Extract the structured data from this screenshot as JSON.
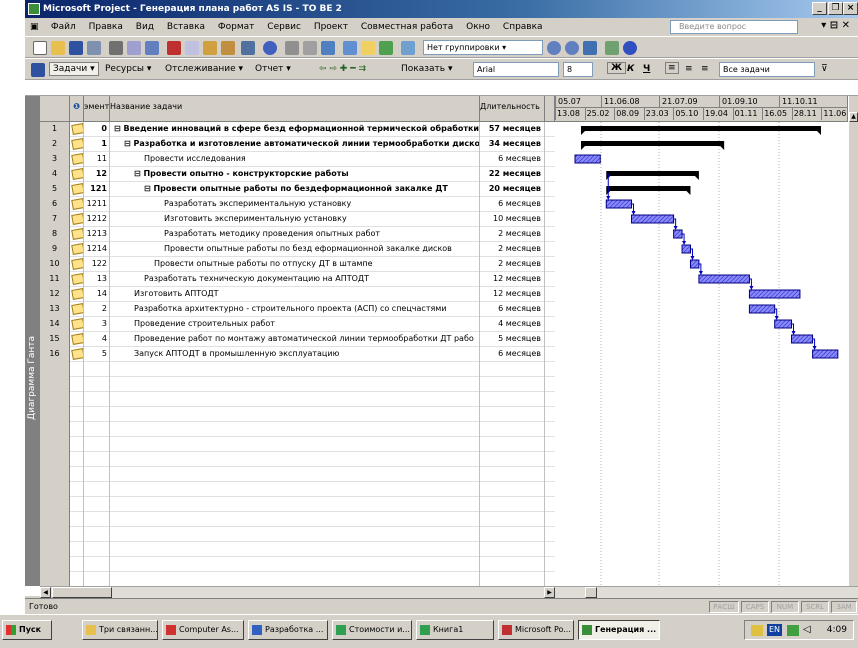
{
  "window": {
    "title": "Microsoft Project - Генерация плана работ AS IS - TO BE 2",
    "ask_placeholder": "Введите вопрос"
  },
  "menu": [
    "Файл",
    "Правка",
    "Вид",
    "Вставка",
    "Формат",
    "Сервис",
    "Проект",
    "Совместная работа",
    "Окно",
    "Справка"
  ],
  "toolbar1": {
    "grouping_label": "Нет группировки"
  },
  "toolbar2": {
    "tasks_label": "Задачи",
    "resources_label": "Ресурсы",
    "tracking_label": "Отслеживание",
    "report_label": "Отчет",
    "show_label": "Показать",
    "font_name": "Arial",
    "font_size": "8",
    "bold_label": "Ж",
    "italic_label": "К",
    "underline_label": "Ч",
    "filter_value": "Все задачи"
  },
  "view_tab": "Диаграмма Ганта",
  "columns": {
    "wbs": "эмент",
    "name": "Название задачи",
    "duration": "Длительность"
  },
  "timescale": {
    "top": [
      "05.07",
      "11.06.08",
      "21.07.09",
      "01.09.10",
      "11.10.11"
    ],
    "bottom": [
      "13.08",
      "25.02",
      "08.09",
      "23.03",
      "05.10",
      "19.04",
      "01.11",
      "16.05",
      "28.11",
      "11.06"
    ]
  },
  "tasks": [
    {
      "id": "1",
      "wbs": "0",
      "name": "⊟ Введение инноваций  в сфере безд еформационной термической обработки д",
      "duration": "57 месяцев",
      "bold": true,
      "indent": 0
    },
    {
      "id": "2",
      "wbs": "1",
      "name": "⊟ Разработка и изготовление автоматической линии термообработки дисков",
      "duration": "34 месяцев",
      "bold": true,
      "indent": 1
    },
    {
      "id": "3",
      "wbs": "11",
      "name": "Провести  исследования",
      "duration": "6 месяцев",
      "bold": false,
      "indent": 3
    },
    {
      "id": "4",
      "wbs": "12",
      "name": "⊟ Провести опытно - конструкторские работы",
      "duration": "22 месяцев",
      "bold": true,
      "indent": 2
    },
    {
      "id": "5",
      "wbs": "121",
      "name": "⊟ Провести опытные работы по  бездеформационной закалке ДТ",
      "duration": "20 месяцев",
      "bold": true,
      "indent": 3
    },
    {
      "id": "6",
      "wbs": "1211",
      "name": "Разработать экспериментальную  установку",
      "duration": "6 месяцев",
      "bold": false,
      "indent": 5
    },
    {
      "id": "7",
      "wbs": "1212",
      "name": "Изготовить  экспериментальную  установку",
      "duration": "10 месяцев",
      "bold": false,
      "indent": 5
    },
    {
      "id": "8",
      "wbs": "1213",
      "name": "Разработать  методику  проведения  опытных работ",
      "duration": "2 месяцев",
      "bold": false,
      "indent": 5
    },
    {
      "id": "9",
      "wbs": "1214",
      "name": "Провести  опытные  работы по безд еформационной закалке дисков",
      "duration": "2 месяцев",
      "bold": false,
      "indent": 5
    },
    {
      "id": "10",
      "wbs": "122",
      "name": "Провести опытные работы по отпуску ДТ в штампе",
      "duration": "2 месяцев",
      "bold": false,
      "indent": 4
    },
    {
      "id": "11",
      "wbs": "13",
      "name": "Разработать техническую документацию на АПТОДТ",
      "duration": "12 месяцев",
      "bold": false,
      "indent": 3
    },
    {
      "id": "12",
      "wbs": "14",
      "name": "Изготовить АПТОДТ",
      "duration": "12 месяцев",
      "bold": false,
      "indent": 2
    },
    {
      "id": "13",
      "wbs": "2",
      "name": "Разработка архитектурно -  строительного проекта (АСП) со спецчастями",
      "duration": "6 месяцев",
      "bold": false,
      "indent": 2
    },
    {
      "id": "14",
      "wbs": "3",
      "name": "Проведение строительных работ",
      "duration": "4 месяцев",
      "bold": false,
      "indent": 2
    },
    {
      "id": "15",
      "wbs": "4",
      "name": "Проведение работ по монтажу автоматической  линии  термообработки ДТ рабо",
      "duration": "5 месяцев",
      "bold": false,
      "indent": 2
    },
    {
      "id": "16",
      "wbs": "5",
      "name": "Запуск АПТОДТ в промышленную эксплуатацию",
      "duration": "6 месяцев",
      "bold": false,
      "indent": 2
    }
  ],
  "status": {
    "ready": "Готово",
    "indicators": [
      "РАСШ",
      "CAPS",
      "NUM",
      "SCRL",
      "ЗАМ"
    ]
  },
  "taskbar": {
    "start": "Пуск",
    "buttons": [
      "Три связанн...",
      "Computer As...",
      "Разработка ...",
      "Стоимости и...",
      "Книга1",
      "Microsoft Po...",
      "Генерация ..."
    ],
    "lang": "EN",
    "clock": "4:09"
  }
}
